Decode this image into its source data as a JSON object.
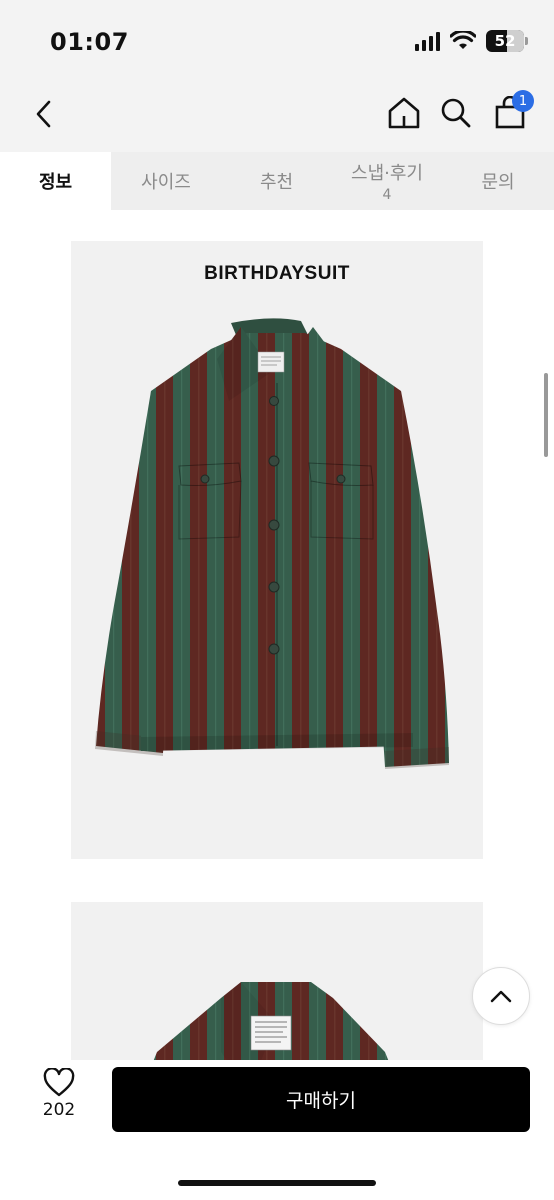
{
  "status_bar": {
    "time": "01:07",
    "battery_level": "52"
  },
  "nav": {
    "cart_badge": "1"
  },
  "tabs": [
    {
      "label": "정보",
      "count": ""
    },
    {
      "label": "사이즈",
      "count": ""
    },
    {
      "label": "추천",
      "count": ""
    },
    {
      "label": "스냅·후기",
      "count": "4"
    },
    {
      "label": "문의",
      "count": ""
    }
  ],
  "product": {
    "brand": "BIRTHDAYSUIT"
  },
  "colors": {
    "stripe_green": "#365e4c",
    "stripe_brown": "#5e2822",
    "accent_badge": "#2b6de5",
    "buy_button": "#000000"
  },
  "bottom_bar": {
    "like_count": "202",
    "buy_label": "구매하기"
  }
}
